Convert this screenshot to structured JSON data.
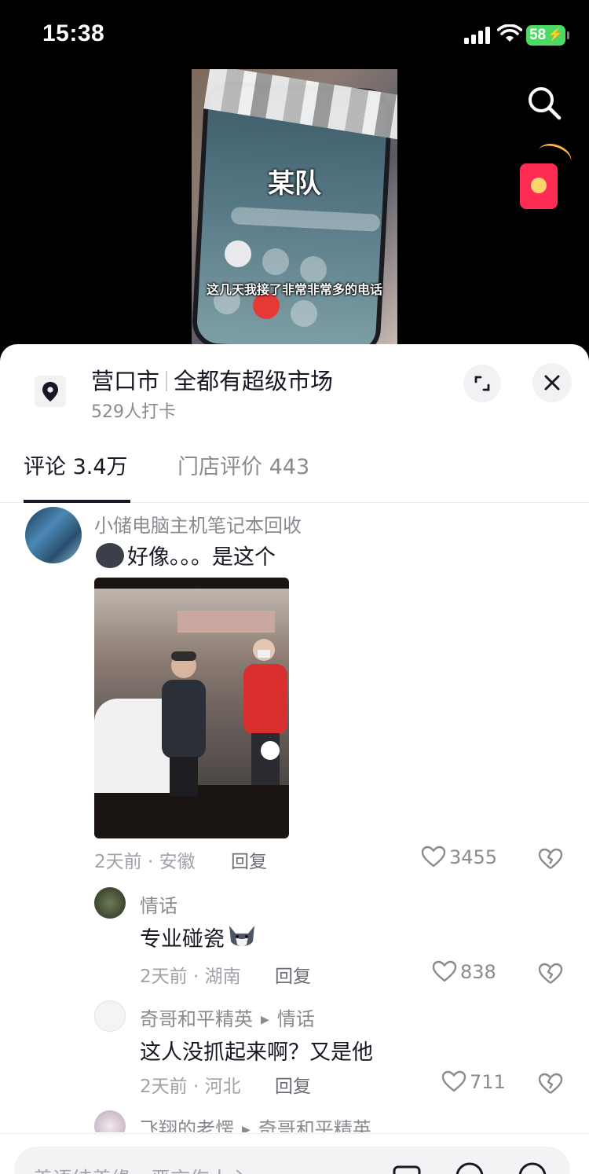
{
  "status_bar": {
    "time": "15:38",
    "battery": "58"
  },
  "video": {
    "caller_name": "某队",
    "subtitle": "这几天我接了非常非常多的电话"
  },
  "location": {
    "city": "营口市",
    "store": "全都有超级市场",
    "checkins": "529人打卡"
  },
  "tabs": {
    "comments": "评论 3.4万",
    "reviews": "门店评价 443"
  },
  "comments": [
    {
      "user": "小储电脑主机笔记本回收",
      "text": "好像。。。是这个",
      "meta": "2天前 · 安徽",
      "reply": "回复",
      "likes": "3455"
    },
    {
      "user": "情话",
      "text": "专业碰瓷",
      "meta": "2天前 · 湖南",
      "reply": "回复",
      "likes": "838"
    },
    {
      "user": "奇哥和平精英",
      "reply_to": "情话",
      "text": "这人没抓起来啊？又是他",
      "meta": "2天前 · 河北",
      "reply": "回复",
      "likes": "711"
    },
    {
      "user": "飞翔的老愣",
      "reply_to": "奇哥和平精英"
    }
  ],
  "input": {
    "placeholder": "善语结善缘，恶言伤人心"
  }
}
